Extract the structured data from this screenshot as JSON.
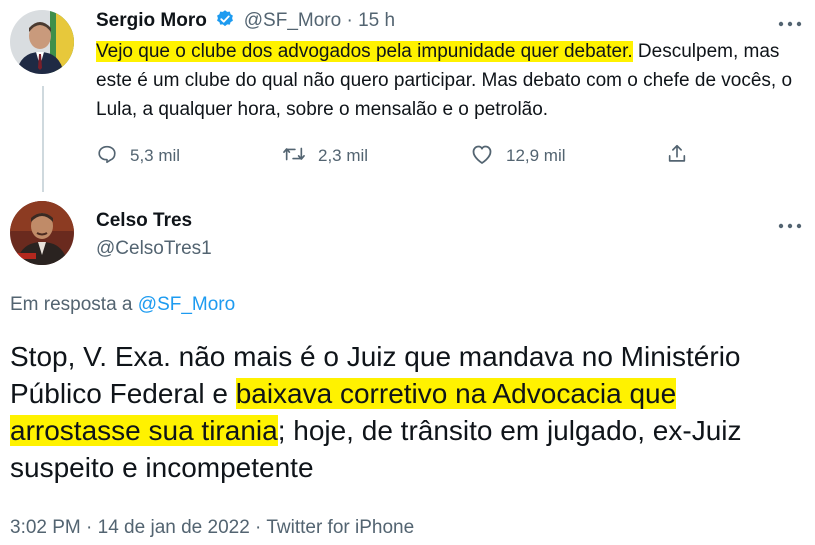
{
  "tweet1": {
    "author_name": "Sergio Moro",
    "handle": "@SF_Moro",
    "separator": " · ",
    "time": "15 h",
    "text_highlight": "Vejo que o clube dos advogados pela impunidade quer debater.",
    "text_rest": " Desculpem, mas este é um clube do qual não quero participar. Mas debato com o chefe de vocês, o Lula, a qualquer hora, sobre o mensalão e o petrolão.",
    "replies": "5,3 mil",
    "retweets": "2,3 mil",
    "likes": "12,9 mil",
    "verified": true
  },
  "tweet2": {
    "author_name": "Celso Tres",
    "handle": "@CelsoTres1",
    "reply_prefix": "Em resposta a ",
    "reply_handle": "@SF_Moro",
    "text_part1": "Stop, V. Exa. não mais é o Juiz que mandava no Ministério Público Federal e ",
    "text_highlight": "baixava corretivo na Advocacia que arrostasse sua tirania",
    "text_part2": "; hoje, de trânsito em julgado, ex-Juiz suspeito e incompetente",
    "timestamp": "3:02 PM · 14 de jan de 2022 · Twitter for iPhone"
  },
  "icons": {
    "verified": "verified-badge-icon",
    "reply": "reply-icon",
    "retweet": "retweet-icon",
    "like": "heart-icon",
    "share": "share-icon",
    "more": "more-icon"
  },
  "colors": {
    "link": "#1d9bf0",
    "secondary_text": "#536471",
    "highlight": "#fff200"
  }
}
